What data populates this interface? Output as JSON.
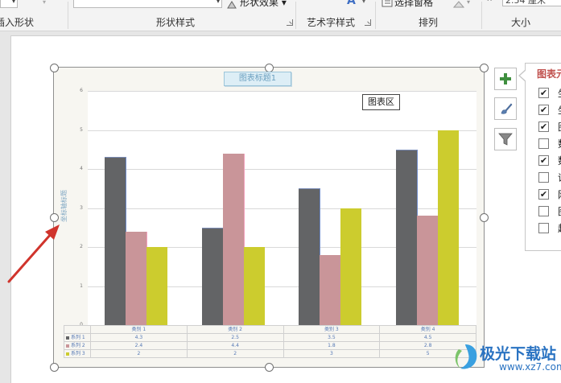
{
  "ribbon": {
    "insert_shape_group": "插入形状",
    "shape_style_group": "形状样式",
    "shape_effect_label": "形状效果",
    "wordart_group": "艺术字样式",
    "select_pane_label": "选择窗格",
    "arrange_group": "排列",
    "size_value": "2.54 厘米",
    "size_group": "大小"
  },
  "chart": {
    "title": "图表标题1",
    "y_axis_title": "坐标轴标题",
    "tooltip": "图表区",
    "y_ticks": [
      "0",
      "1",
      "2",
      "3",
      "4",
      "5",
      "6"
    ]
  },
  "chart_data": {
    "type": "bar",
    "title": "图表标题1",
    "ylabel": "坐标轴标题",
    "xlabel": "",
    "ylim": [
      0,
      6
    ],
    "grid": true,
    "categories": [
      "类别 1",
      "类别 2",
      "类别 3",
      "类别 4"
    ],
    "series": [
      {
        "name": "系列 1",
        "values": [
          4.3,
          2.5,
          3.5,
          4.5
        ],
        "labels": [
          "4.3",
          "2.5",
          "3.5",
          "4.5"
        ],
        "color": "#636466"
      },
      {
        "name": "系列 2",
        "values": [
          2.4,
          4.4,
          1.8,
          2.8
        ],
        "labels": [
          "2.4",
          "4.4",
          "1.8",
          "2.8"
        ],
        "color": "#c99599"
      },
      {
        "name": "系列 3",
        "values": [
          2,
          2,
          3,
          5
        ],
        "labels": [
          "2",
          "2",
          "3",
          "5"
        ],
        "color": "#cccc2e"
      }
    ],
    "data_table": true
  },
  "side_buttons": [
    {
      "icon": "plus-icon"
    },
    {
      "icon": "brush-icon"
    },
    {
      "icon": "filter-icon"
    }
  ],
  "elements_panel": {
    "title": "图表元素",
    "items": [
      {
        "label": "坐",
        "checked": true
      },
      {
        "label": "坐",
        "checked": true
      },
      {
        "label": "图",
        "checked": true
      },
      {
        "label": "数",
        "checked": false
      },
      {
        "label": "数",
        "checked": true
      },
      {
        "label": "误",
        "checked": false
      },
      {
        "label": "网",
        "checked": true
      },
      {
        "label": "图",
        "checked": false
      },
      {
        "label": "趋",
        "checked": false
      }
    ]
  },
  "watermark": {
    "text": "极光下载站",
    "url": "www.xz7.com",
    "color": "#2a73c2"
  },
  "colors": {
    "arrow": "#d0342c",
    "panel_title": "#c0504d"
  }
}
